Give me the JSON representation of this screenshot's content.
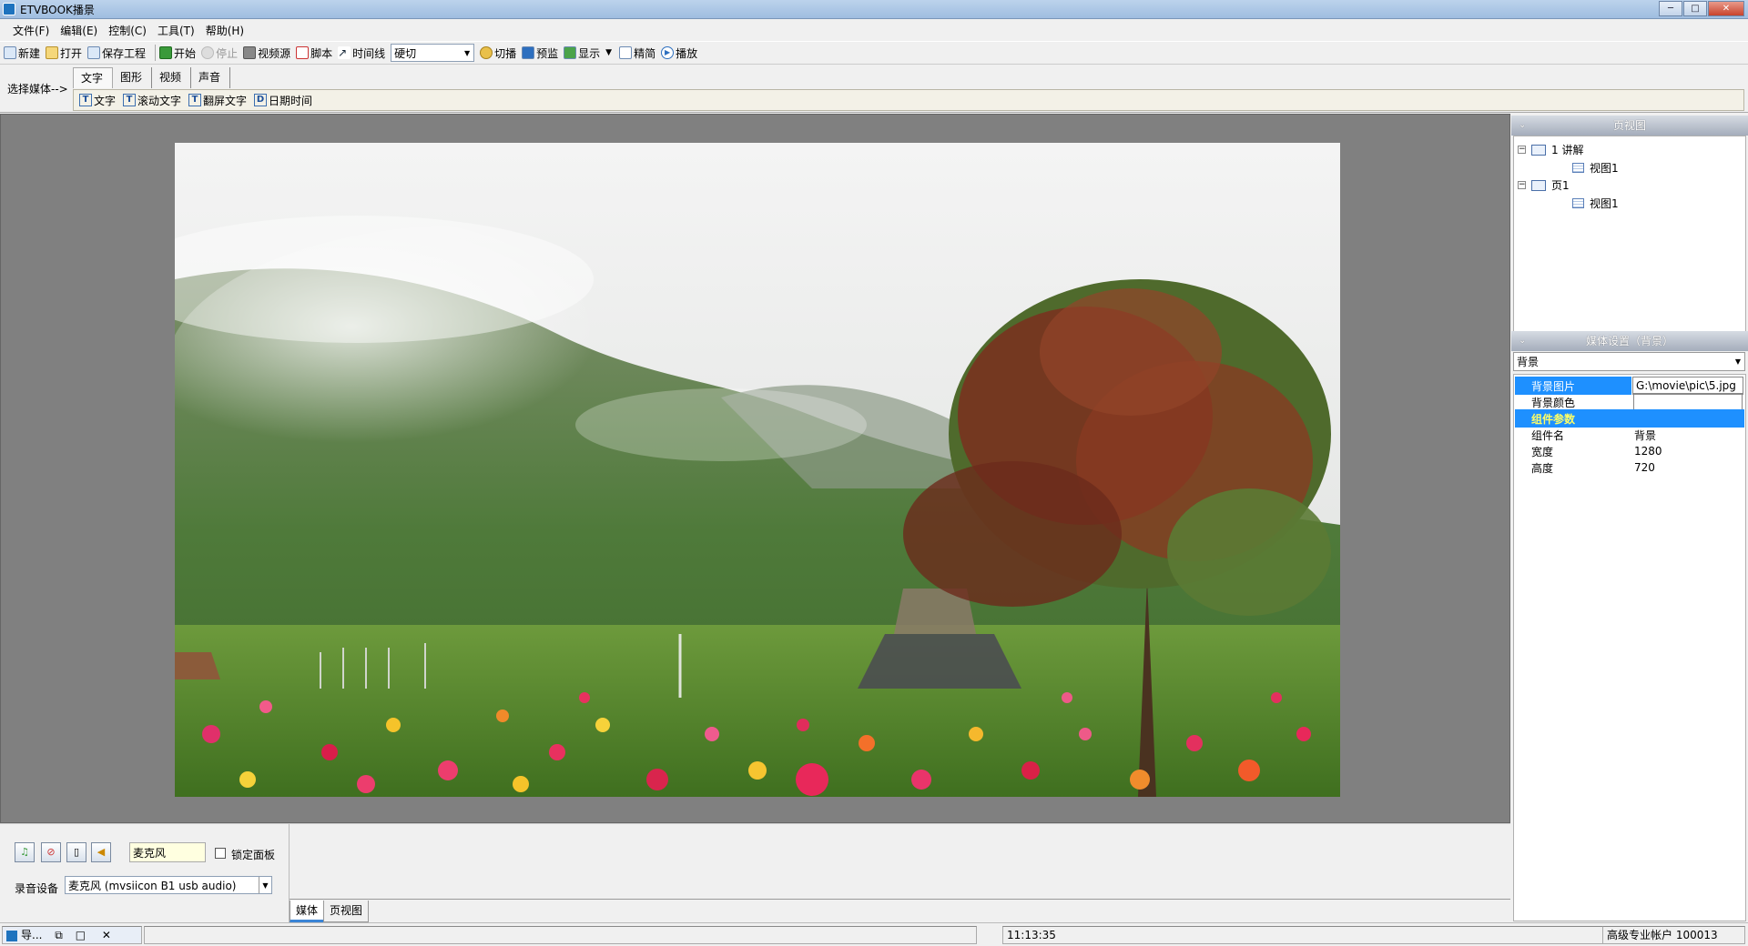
{
  "window": {
    "title": "ETVBOOK播景"
  },
  "menu": [
    "文件(F)",
    "编辑(E)",
    "控制(C)",
    "工具(T)",
    "帮助(H)"
  ],
  "toolbar": {
    "new": "新建",
    "open": "打开",
    "save": "保存工程",
    "start": "开始",
    "stop": "停止",
    "video_source": "视频源",
    "script": "脚本",
    "timeline": "时间线",
    "transition": "硬切",
    "switch": "切播",
    "preview": "预监",
    "display": "显示",
    "simple": "精简",
    "play": "播放"
  },
  "media": {
    "select_label": "选择媒体-->",
    "tabs": [
      "文字",
      "图形",
      "视频",
      "声音"
    ],
    "text_tools": [
      "文字",
      "滚动文字",
      "翻屏文字",
      "日期时间"
    ]
  },
  "page_view": {
    "header": "页视图",
    "tree": [
      {
        "label": "1 讲解",
        "children": [
          "视图1"
        ]
      },
      {
        "label": "页1",
        "children": [
          "视图1"
        ]
      }
    ]
  },
  "media_settings": {
    "header": "媒体设置（背景）",
    "selected": "背景",
    "props": {
      "bg_image_key": "背景图片",
      "bg_image_val": "G:\\movie\\pic\\5.jpg",
      "bg_color_key": "背景颜色",
      "group": "组件参数",
      "name_key": "组件名",
      "name_val": "背景",
      "width_key": "宽度",
      "width_val": "1280",
      "height_key": "高度",
      "height_val": "720"
    }
  },
  "audio": {
    "input_value": "麦克风",
    "lock_label": "锁定面板",
    "device_label": "录音设备",
    "device_value": "麦克风 (mvsiicon B1 usb audio)"
  },
  "bottom_tabs": [
    "媒体",
    "页视图"
  ],
  "status": {
    "nav": "导...",
    "time": "11:13:35",
    "account": "高级专业帐户 100013"
  },
  "colors": {
    "selection": "#1e90ff",
    "highlight_text": "#ffff66"
  }
}
